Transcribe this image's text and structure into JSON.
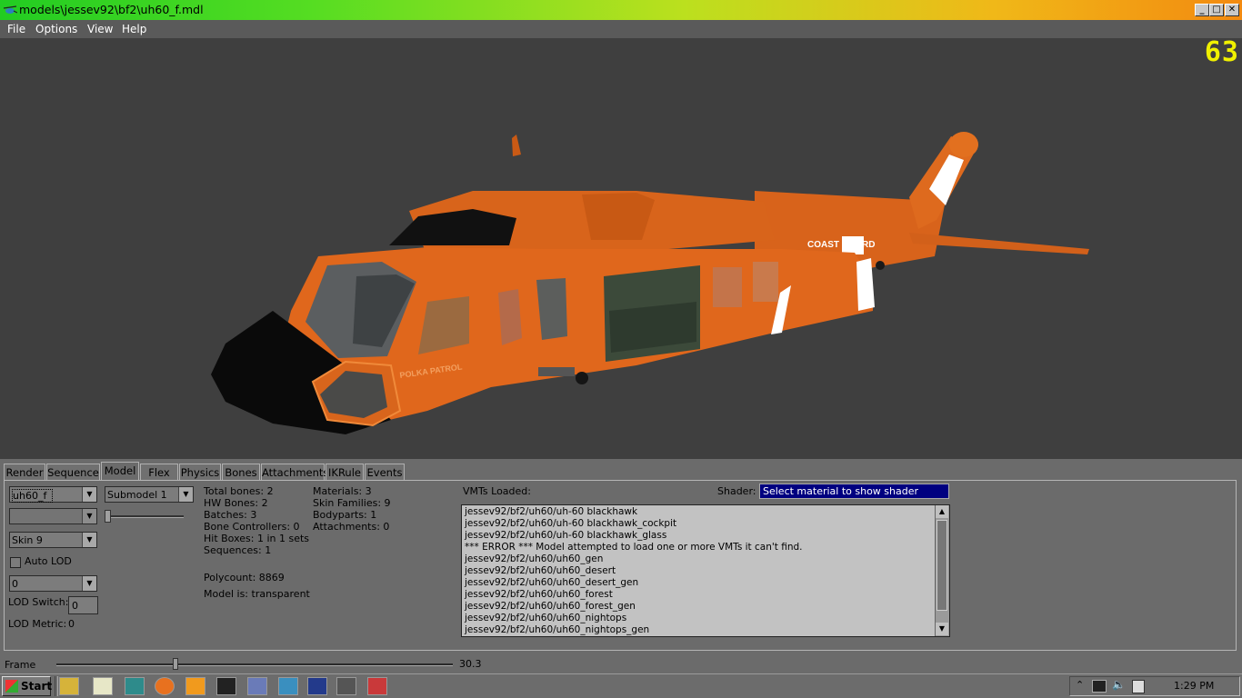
{
  "window": {
    "title": "models\\jessev92\\bf2\\uh60_f.mdl",
    "minimize": "_",
    "maximize": "□",
    "close": "✕"
  },
  "menu": [
    "File",
    "Options",
    "View",
    "Help"
  ],
  "viewport": {
    "fps": "63",
    "model_text_1": "COAST GUARD",
    "model_text_2": "POLKA PATROL",
    "colors": {
      "body": "#e0671c",
      "background": "#3f3f3f",
      "fps": "#f0f000"
    }
  },
  "tabs": [
    "Render",
    "Sequence",
    "Model",
    "Flex",
    "Physics",
    "Bones",
    "Attachments",
    "IKRule",
    "Events"
  ],
  "active_tab": "Model",
  "model_panel": {
    "model_select": "uh60_f",
    "submodel_select": "Submodel 1",
    "skin_select": "Skin 9",
    "auto_lod_label": "Auto LOD",
    "lod_select": "0",
    "lod_switch_label": "LOD Switch:",
    "lod_switch_value": "0",
    "lod_metric_label": "LOD Metric:",
    "lod_metric_value": "0",
    "stats_col1": [
      "Total bones: 2",
      "HW Bones: 2",
      "Batches: 3",
      "Bone Controllers: 0",
      "Hit Boxes: 1 in 1 sets",
      "Sequences: 1"
    ],
    "polycount": "Polycount: 8869",
    "model_is": "Model is: transparent",
    "stats_col2": [
      "Materials: 3",
      "Skin Families: 9",
      "Bodyparts: 1",
      "Attachments: 0"
    ],
    "vmts_label": "VMTs Loaded:",
    "shader_label": "Shader:",
    "shader_value": "Select material to show shader",
    "vmts": [
      "jessev92/bf2/uh60/uh-60 blackhawk",
      "jessev92/bf2/uh60/uh-60 blackhawk_cockpit",
      "jessev92/bf2/uh60/uh-60 blackhawk_glass",
      "*** ERROR *** Model attempted to load one or more VMTs it can't find.",
      "jessev92/bf2/uh60/uh60_gen",
      "jessev92/bf2/uh60/uh60_desert",
      "jessev92/bf2/uh60/uh60_desert_gen",
      "jessev92/bf2/uh60/uh60_forest",
      "jessev92/bf2/uh60/uh60_forest_gen",
      "jessev92/bf2/uh60/uh60_nightops",
      "jessev92/bf2/uh60/uh60_nightops_gen"
    ]
  },
  "frame": {
    "label": "Frame",
    "value": "30.3",
    "progress": 0.3
  },
  "taskbar": {
    "start": "Start",
    "quick_icons": [
      "folder-icon",
      "notepad-icon",
      "gimp-icon",
      "firefox-icon",
      "media-player-icon",
      "steam-icon",
      "editor-icon",
      "hlmv-icon",
      "mail-icon",
      "tool-icon",
      "acrobat-icon"
    ],
    "clock": "1:29 PM"
  }
}
